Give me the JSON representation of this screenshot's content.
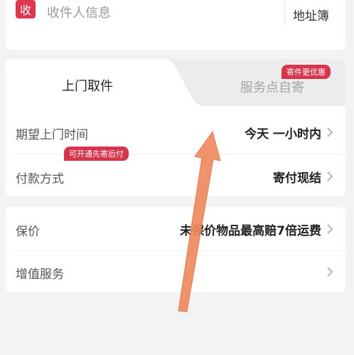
{
  "receiver": {
    "badge": "收",
    "label": "收件人信息",
    "address_book": "地址簿"
  },
  "tabs": {
    "active_label": "上门取件",
    "inactive_label": "服务点自寄",
    "inactive_badge": "寄件更优惠"
  },
  "pickup_rows": [
    {
      "label": "期望上门时间",
      "value": "今天 一小时内"
    },
    {
      "label": "付款方式",
      "value": "寄付现结",
      "badge": "可开通先寄后付"
    }
  ],
  "service_rows": [
    {
      "label": "保价",
      "value": "未保价物品最高赔7倍运费"
    },
    {
      "label": "增值服务",
      "value": ""
    }
  ],
  "colors": {
    "accent_red": "#d8344c",
    "annotation_arrow": "#f08a5d"
  },
  "icons": {
    "chevron": "chevron-right-icon",
    "annotation": "arrow-up-icon"
  }
}
